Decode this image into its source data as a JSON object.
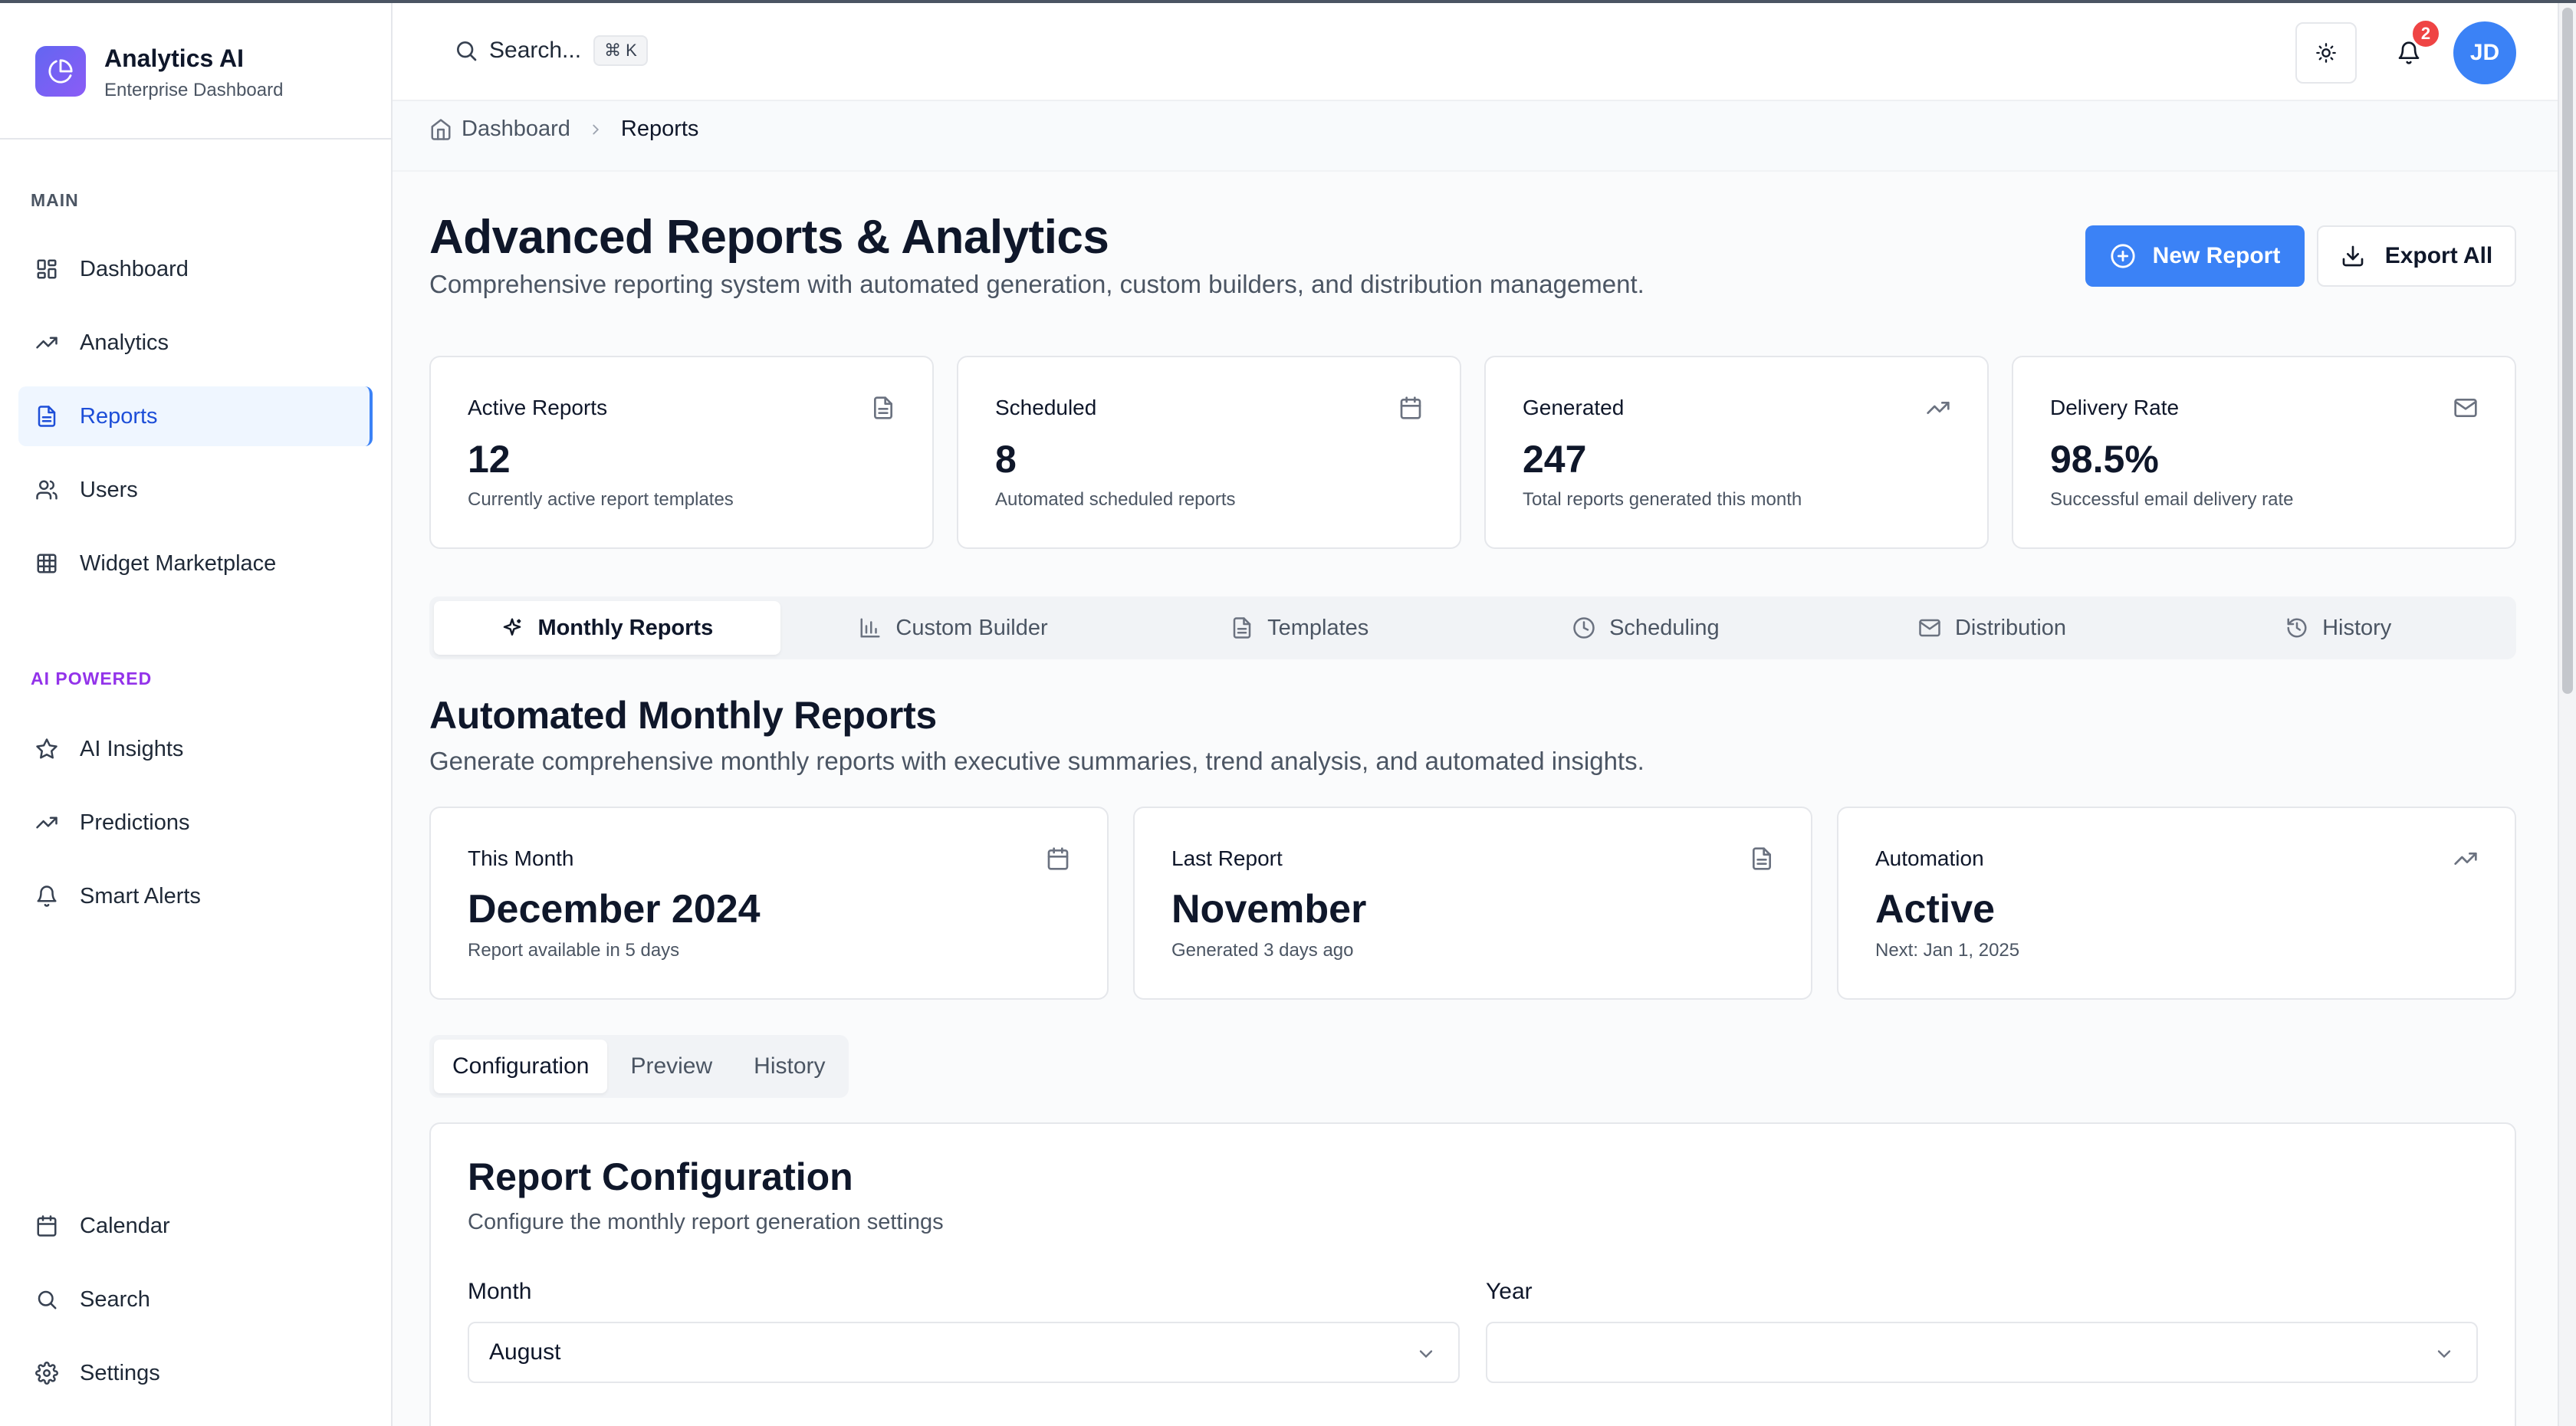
{
  "app": {
    "name": "Analytics AI",
    "subtitle": "Enterprise Dashboard"
  },
  "sidebar": {
    "main_label": "MAIN",
    "main_items": [
      {
        "label": "Dashboard",
        "icon": "dashboard-icon"
      },
      {
        "label": "Analytics",
        "icon": "trending-up-icon"
      },
      {
        "label": "Reports",
        "icon": "file-text-icon",
        "active": true
      },
      {
        "label": "Users",
        "icon": "users-icon"
      },
      {
        "label": "Widget Marketplace",
        "icon": "grid-icon"
      }
    ],
    "ai_label": "AI POWERED",
    "ai_items": [
      {
        "label": "AI Insights",
        "icon": "star-icon"
      },
      {
        "label": "Predictions",
        "icon": "trending-up-icon"
      },
      {
        "label": "Smart Alerts",
        "icon": "bell-icon"
      }
    ],
    "bottom_items": [
      {
        "label": "Calendar",
        "icon": "calendar-icon"
      },
      {
        "label": "Search",
        "icon": "search-icon"
      },
      {
        "label": "Settings",
        "icon": "gear-icon"
      }
    ]
  },
  "topbar": {
    "search_placeholder": "Search...",
    "shortcut_symbol": "⌘",
    "shortcut_key": "K",
    "notification_count": "2",
    "avatar_initials": "JD"
  },
  "breadcrumb": {
    "home": "Dashboard",
    "current": "Reports"
  },
  "page": {
    "title": "Advanced Reports & Analytics",
    "subtitle": "Comprehensive reporting system with automated generation, custom builders, and distribution management.",
    "new_report_label": "New Report",
    "export_all_label": "Export All"
  },
  "stats": [
    {
      "label": "Active Reports",
      "value": "12",
      "desc": "Currently active report templates",
      "icon": "file-text-icon"
    },
    {
      "label": "Scheduled",
      "value": "8",
      "desc": "Automated scheduled reports",
      "icon": "calendar-icon"
    },
    {
      "label": "Generated",
      "value": "247",
      "desc": "Total reports generated this month",
      "icon": "trending-up-icon"
    },
    {
      "label": "Delivery Rate",
      "value": "98.5%",
      "desc": "Successful email delivery rate",
      "icon": "mail-icon"
    }
  ],
  "tabs": [
    {
      "label": "Monthly Reports",
      "icon": "sparkles-icon",
      "active": true
    },
    {
      "label": "Custom Builder",
      "icon": "bar-chart-icon"
    },
    {
      "label": "Templates",
      "icon": "file-text-icon"
    },
    {
      "label": "Scheduling",
      "icon": "clock-icon"
    },
    {
      "label": "Distribution",
      "icon": "mail-icon"
    },
    {
      "label": "History",
      "icon": "history-icon"
    }
  ],
  "monthly": {
    "title": "Automated Monthly Reports",
    "subtitle": "Generate comprehensive monthly reports with executive summaries, trend analysis, and automated insights.",
    "cards": [
      {
        "label": "This Month",
        "value": "December 2024",
        "desc": "Report available in 5 days",
        "icon": "calendar-icon"
      },
      {
        "label": "Last Report",
        "value": "November",
        "desc": "Generated 3 days ago",
        "icon": "file-text-icon"
      },
      {
        "label": "Automation",
        "value": "Active",
        "desc": "Next: Jan 1, 2025",
        "icon": "trending-up-icon"
      }
    ],
    "subtabs": [
      {
        "label": "Configuration",
        "active": true
      },
      {
        "label": "Preview"
      },
      {
        "label": "History"
      }
    ]
  },
  "config": {
    "title": "Report Configuration",
    "subtitle": "Configure the monthly report generation settings",
    "month_label": "Month",
    "month_value": "August",
    "year_label": "Year",
    "year_value": ""
  }
}
